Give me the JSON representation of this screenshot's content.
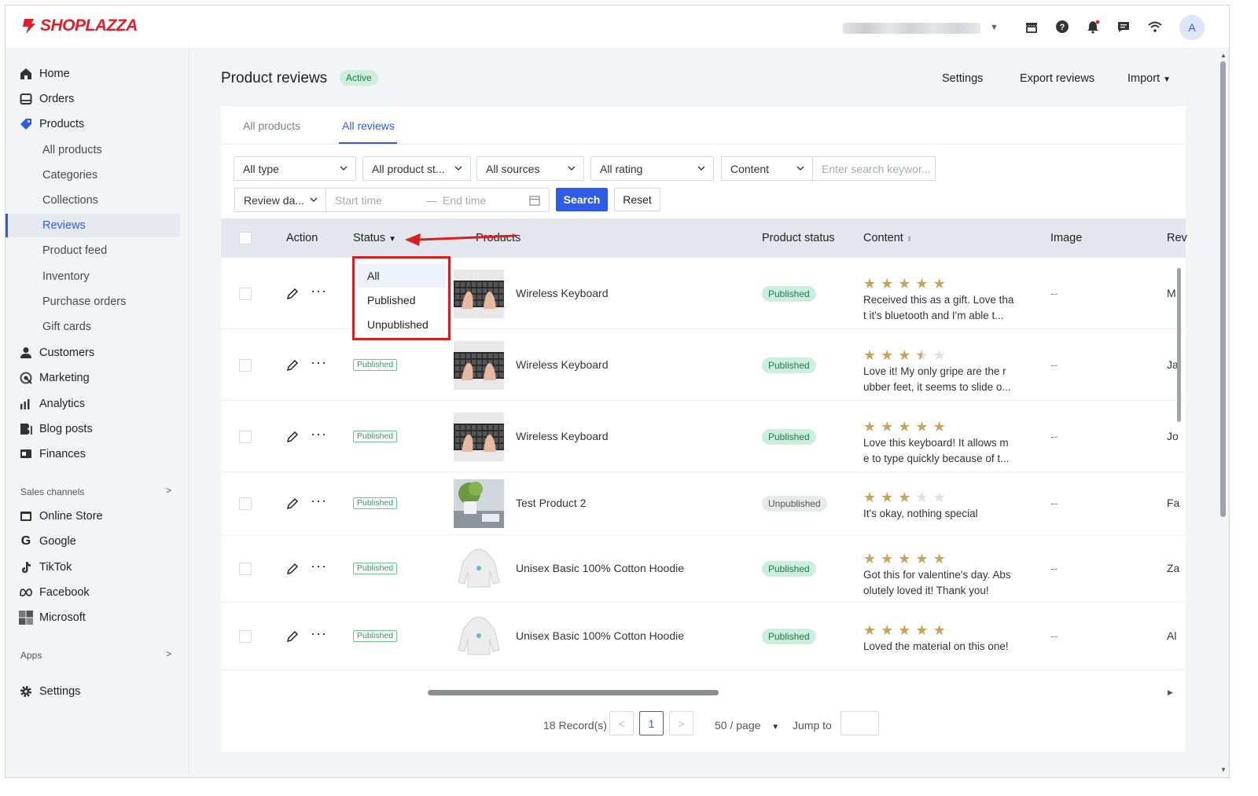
{
  "brand": {
    "name": "SHOPLAZZA",
    "color": "#e11d2a"
  },
  "topbar": {
    "icons": [
      "store-icon",
      "help-icon",
      "bell-icon",
      "message-icon",
      "wifi-icon"
    ],
    "avatar_letter": "A"
  },
  "sidebar": {
    "items": [
      {
        "label": "Home",
        "icon": "home-icon"
      },
      {
        "label": "Orders",
        "icon": "orders-icon"
      },
      {
        "label": "Products",
        "icon": "tag-icon"
      },
      {
        "label": "All products"
      },
      {
        "label": "Categories"
      },
      {
        "label": "Collections"
      },
      {
        "label": "Reviews"
      },
      {
        "label": "Product feed"
      },
      {
        "label": "Inventory"
      },
      {
        "label": "Purchase orders"
      },
      {
        "label": "Gift cards"
      },
      {
        "label": "Customers",
        "icon": "person-icon"
      },
      {
        "label": "Marketing",
        "icon": "marketing-icon"
      },
      {
        "label": "Analytics",
        "icon": "analytics-icon"
      },
      {
        "label": "Blog posts",
        "icon": "blog-icon"
      },
      {
        "label": "Finances",
        "icon": "finances-icon"
      }
    ],
    "sales_channels_label": "Sales channels",
    "channels": [
      {
        "label": "Online Store",
        "icon": "store-icon"
      },
      {
        "label": "Google",
        "icon": "google-icon"
      },
      {
        "label": "TikTok",
        "icon": "tiktok-icon"
      },
      {
        "label": "Facebook",
        "icon": "meta-icon"
      },
      {
        "label": "Microsoft",
        "icon": "microsoft-icon"
      }
    ],
    "apps_label": "Apps",
    "settings_label": "Settings"
  },
  "page": {
    "title": "Product reviews",
    "badge": "Active",
    "actions": {
      "settings": "Settings",
      "export": "Export reviews",
      "import": "Import"
    }
  },
  "tabs": [
    "All products",
    "All reviews"
  ],
  "filters": {
    "type": "All type",
    "product_status": "All product st...",
    "sources": "All sources",
    "rating": "All rating",
    "content_field": "Content",
    "search_placeholder": "Enter search keywor...",
    "review_date": "Review da...",
    "start_placeholder": "Start time",
    "end_placeholder": "End time",
    "search_btn": "Search",
    "reset_btn": "Reset"
  },
  "table": {
    "headers": {
      "action": "Action",
      "status": "Status",
      "products": "Products",
      "product_status": "Product status",
      "content": "Content",
      "image": "Image",
      "reviewer": "Rev"
    },
    "rows": [
      {
        "status": "",
        "product": "Wireless Keyboard",
        "product_status": "Published",
        "rating": 5,
        "text1": "Received this as a gift. Love tha",
        "text2": "t it's bluetooth and I'm able t...",
        "image": "--",
        "reviewer": "M"
      },
      {
        "status": "Published",
        "product": "Wireless Keyboard",
        "product_status": "Published",
        "rating": 3.5,
        "text1": "Love it! My only gripe are the r",
        "text2": "ubber feet, it seems to slide o...",
        "image": "--",
        "reviewer": "Ja"
      },
      {
        "status": "Published",
        "product": "Wireless Keyboard",
        "product_status": "Published",
        "rating": 5,
        "text1": "Love this keyboard! It allows m",
        "text2": "e to type quickly because of t...",
        "image": "--",
        "reviewer": "Jo"
      },
      {
        "status": "Published",
        "product": "Test Product 2",
        "product_status": "Unpublished",
        "rating": 3,
        "text1": "It's okay, nothing special",
        "text2": "",
        "image": "--",
        "reviewer": "Fa"
      },
      {
        "status": "Published",
        "product": "Unisex Basic 100% Cotton Hoodie",
        "product_status": "Published",
        "rating": 5,
        "text1": "Got this for valentine's day. Abs",
        "text2": "olutely loved it! Thank you!",
        "image": "--",
        "reviewer": "Za"
      },
      {
        "status": "Published",
        "product": "Unisex Basic 100% Cotton Hoodie",
        "product_status": "Published",
        "rating": 5,
        "text1": "Loved the material on this one!",
        "text2": "",
        "image": "--",
        "reviewer": "Al"
      }
    ]
  },
  "status_dropdown": {
    "options": [
      "All",
      "Published",
      "Unpublished"
    ],
    "highlighted": "All"
  },
  "pagination": {
    "records": "18 Record(s)",
    "current": "1",
    "per_page": "50 / page",
    "jump_label": "Jump to"
  },
  "colors": {
    "accent": "#2e5ce6",
    "published_bg": "#cdeedd",
    "published_text": "#1e7a4a",
    "star": "#c9a35c",
    "annotation_red": "#d81e1e"
  }
}
